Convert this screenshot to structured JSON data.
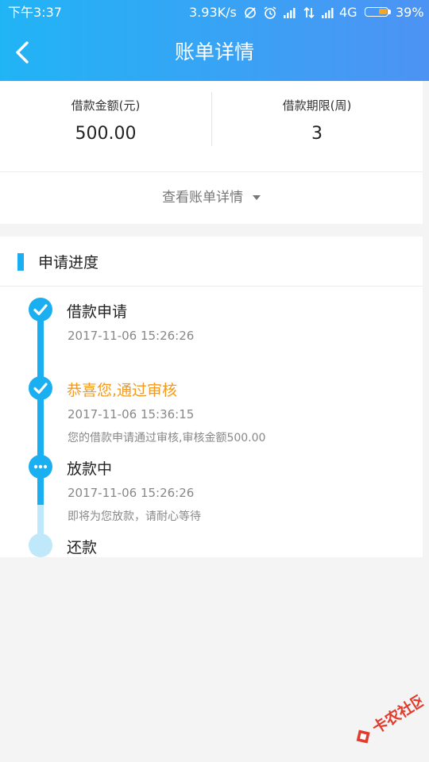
{
  "status_bar": {
    "time": "下午3:37",
    "speed": "3.93K/s",
    "network": "4G",
    "battery": "39%",
    "battery_level": 0.39
  },
  "header": {
    "title": "账单详情"
  },
  "loan": {
    "amount_label": "借款金额(元)",
    "amount_value": "500.00",
    "term_label": "借款期限(周)",
    "term_value": "3",
    "view_details": "查看账单详情"
  },
  "progress": {
    "title": "申请进度",
    "steps": [
      {
        "title": "借款申请",
        "time": "2017-11-06 15:26:26",
        "desc": ""
      },
      {
        "title": "恭喜您,通过审核",
        "time": "2017-11-06 15:36:15",
        "desc": "您的借款申请通过审核,审核金额500.00"
      },
      {
        "title": "放款中",
        "time": "2017-11-06 15:26:26",
        "desc": "即将为您放款，请耐心等待"
      },
      {
        "title": "还款",
        "time": "",
        "desc": ""
      }
    ]
  },
  "watermark": {
    "text": "卡农社区"
  },
  "colors": {
    "accent": "#19aff0",
    "highlight": "#f39a1e",
    "pending": "#bfe9fb"
  }
}
